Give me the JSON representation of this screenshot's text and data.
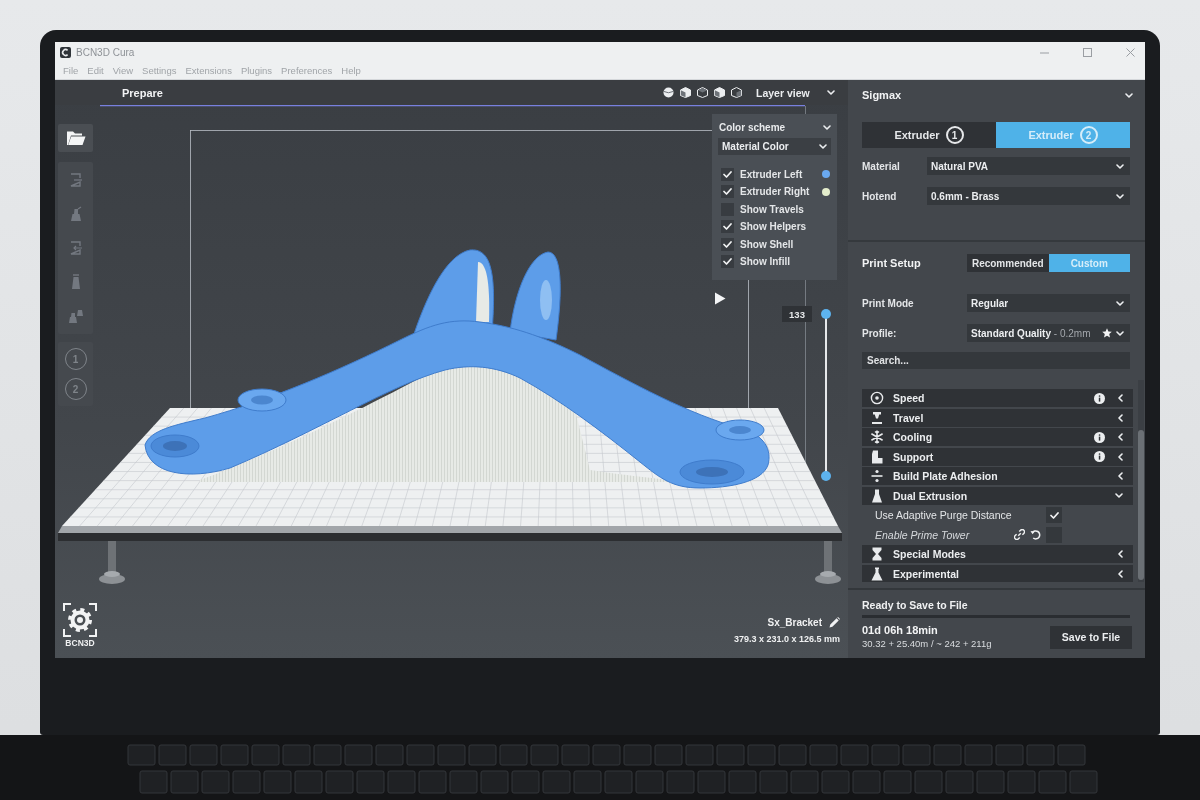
{
  "window": {
    "title": "BCN3D Cura"
  },
  "menu": [
    "File",
    "Edit",
    "View",
    "Settings",
    "Extensions",
    "Plugins",
    "Preferences",
    "Help"
  ],
  "stage_tabs": [
    {
      "label": "Prepare",
      "selected": true
    }
  ],
  "view_mode": {
    "value": "Layer view"
  },
  "tools": [
    {
      "disabled": true
    },
    {
      "disabled": true
    },
    {
      "disabled": true
    },
    {
      "disabled": true
    },
    {
      "disabled": true
    }
  ],
  "extruder_tools": [
    {
      "number": "1",
      "disabled": true
    },
    {
      "number": "2",
      "disabled": true
    }
  ],
  "color_scheme": {
    "title": "Color scheme",
    "scheme": "Material Color",
    "options": [
      {
        "label": "Extruder Left",
        "checked": true,
        "color": "#6aa9f0"
      },
      {
        "label": "Extruder Right",
        "checked": true,
        "color": "#e4edcc"
      },
      {
        "label": "Show Travels",
        "checked": false
      },
      {
        "label": "Show Helpers",
        "checked": true
      },
      {
        "label": "Show Shell",
        "checked": true
      },
      {
        "label": "Show Infill",
        "checked": true
      }
    ]
  },
  "layer_slider": {
    "value": "133",
    "level": 1
  },
  "object": {
    "name": "Sx_Bracket",
    "dimensions": "379.3 x 231.0 x 126.5 mm"
  },
  "logo": {
    "text": "BCN3D"
  },
  "printer": {
    "name": "Sigmax",
    "extruders": [
      {
        "label": "Extruder",
        "number": "1",
        "selected": false
      },
      {
        "label": "Extruder",
        "number": "2",
        "selected": true
      }
    ],
    "fields": [
      {
        "label": "Material",
        "value": "Natural PVA"
      },
      {
        "label": "Hotend",
        "value": "0.6mm - Brass"
      }
    ]
  },
  "print_setup": {
    "title": "Print Setup",
    "modes": [
      {
        "label": "Recommended",
        "selected": false
      },
      {
        "label": "Custom",
        "selected": true
      }
    ],
    "fields": [
      {
        "label": "Print Mode",
        "value": "Regular"
      },
      {
        "label": "Profile:",
        "value": "Standard Quality",
        "detail": "- 0.2mm"
      }
    ],
    "search": {
      "placeholder": "Search..."
    },
    "categories": [
      {
        "label": "Speed",
        "info": true,
        "expanded": false
      },
      {
        "label": "Travel",
        "info": false,
        "expanded": false
      },
      {
        "label": "Cooling",
        "info": true,
        "expanded": false
      },
      {
        "label": "Support",
        "info": true,
        "expanded": false
      },
      {
        "label": "Build Plate Adhesion",
        "info": false,
        "expanded": false
      },
      {
        "label": "Dual Extrusion",
        "info": false,
        "expanded": true,
        "settings": [
          {
            "label": "Use Adaptive Purge Distance",
            "checked": true,
            "linked": false,
            "modified": false
          },
          {
            "label": "Enable Prime Tower",
            "checked": false,
            "linked": true,
            "modified": true
          }
        ]
      },
      {
        "label": "Special Modes",
        "info": false,
        "expanded": false
      },
      {
        "label": "Experimental",
        "info": false,
        "expanded": false
      }
    ]
  },
  "job": {
    "status": "Ready to Save to File",
    "level": 1,
    "time": "01d 06h 18min",
    "usage": "30.32 + 25.40m / ~ 242 + 211g",
    "button": "Save to File"
  }
}
